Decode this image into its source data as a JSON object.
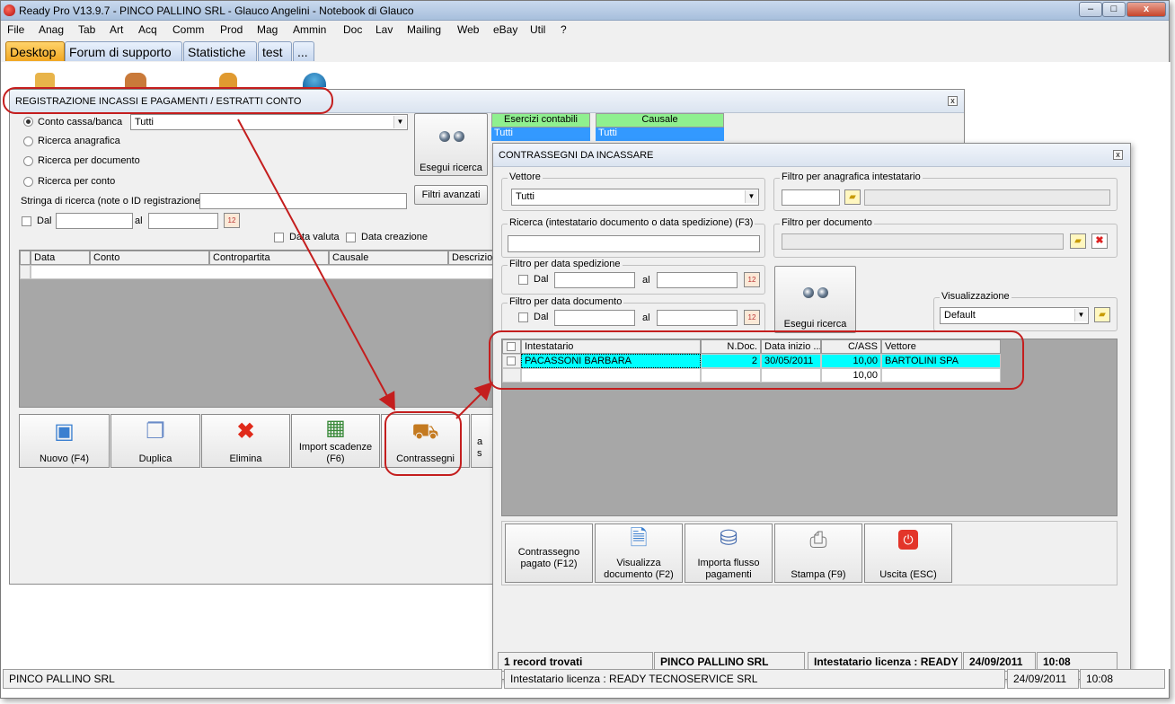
{
  "window": {
    "title": "Ready Pro V13.9.7 - PINCO PALLINO SRL - Glauco Angelini - Notebook di Glauco",
    "min": "‒",
    "max": "□",
    "close": "x"
  },
  "menu": [
    "File",
    "Anag",
    "Tab",
    "Art",
    "Acq",
    "Comm",
    "Prod",
    "Mag",
    "Ammin",
    "Doc",
    "Lav",
    "Mailing",
    "Web",
    "eBay",
    "Util",
    "?"
  ],
  "tabs": [
    "Desktop",
    "Forum di supporto",
    "Statistiche",
    "test",
    "..."
  ],
  "reg": {
    "title": "REGISTRAZIONE INCASSI E PAGAMENTI / ESTRATTI CONTO",
    "radio_options": [
      "Conto cassa/banca",
      "Ricerca anagrafica",
      "Ricerca per documento",
      "Ricerca per conto"
    ],
    "conto_value": "Tutti",
    "search_label": "Stringa di ricerca (note o ID registrazione)",
    "dal": "Dal",
    "al": "al",
    "data_valuta": "Data valuta",
    "data_creazione": "Data creazione",
    "esegui": "Esegui ricerca",
    "filtri": "Filtri avanzati",
    "esercizi_hdr": "Esercizi contabili",
    "esercizi_val": "Tutti",
    "causale_hdr": "Causale",
    "causale_val": "Tutti",
    "columns": [
      "Data",
      "Conto",
      "Contropartita",
      "Causale",
      "Descrizio"
    ],
    "buttons": [
      {
        "label": "Nuovo (F4)",
        "icon": "new-icon"
      },
      {
        "label": "Duplica",
        "icon": "duplicate-icon"
      },
      {
        "label": "Elimina",
        "icon": "delete-icon"
      },
      {
        "label": "Import scadenze (F6)",
        "icon": "import-icon"
      },
      {
        "label": "Contrassegni",
        "icon": "contrassegni-icon"
      },
      {
        "label": "a\ns",
        "icon": ""
      }
    ]
  },
  "contr": {
    "title": "CONTRASSEGNI DA INCASSARE",
    "vettore_label": "Vettore",
    "vettore_value": "Tutti",
    "filtro_anag": "Filtro per anagrafica intestatario",
    "ricerca_label": "Ricerca (intestatario documento o data spedizione) (F3)",
    "filtro_doc": "Filtro per documento",
    "filtro_sped": "Filtro per data spedizione",
    "filtro_datadoc": "Filtro per data documento",
    "dal": "Dal",
    "al": "al",
    "esegui": "Esegui ricerca",
    "visual_label": "Visualizzazione",
    "visual_value": "Default",
    "columns": [
      "Intestatario",
      "N.Doc.",
      "Data inizio ...",
      "C/ASS",
      "Vettore"
    ],
    "rows": [
      {
        "intestatario": "PACASSONI BARBARA",
        "ndoc": "2",
        "data": "30/05/2011",
        "cass": "10,00",
        "vettore": "BARTOLINI SPA"
      }
    ],
    "total": "10,00",
    "buttons": [
      "Contrassegno pagato (F12)",
      "Visualizza documento (F2)",
      "Importa flusso pagamenti",
      "Stampa (F9)",
      "Uscita (ESC)"
    ],
    "status": [
      "1 record trovati",
      "PINCO PALLINO SRL",
      "Intestatario licenza : READY",
      "24/09/2011",
      "10:08"
    ]
  },
  "status": [
    "PINCO PALLINO SRL",
    "Intestatario licenza : READY TECNOSERVICE SRL",
    "24/09/2011",
    "10:08"
  ]
}
